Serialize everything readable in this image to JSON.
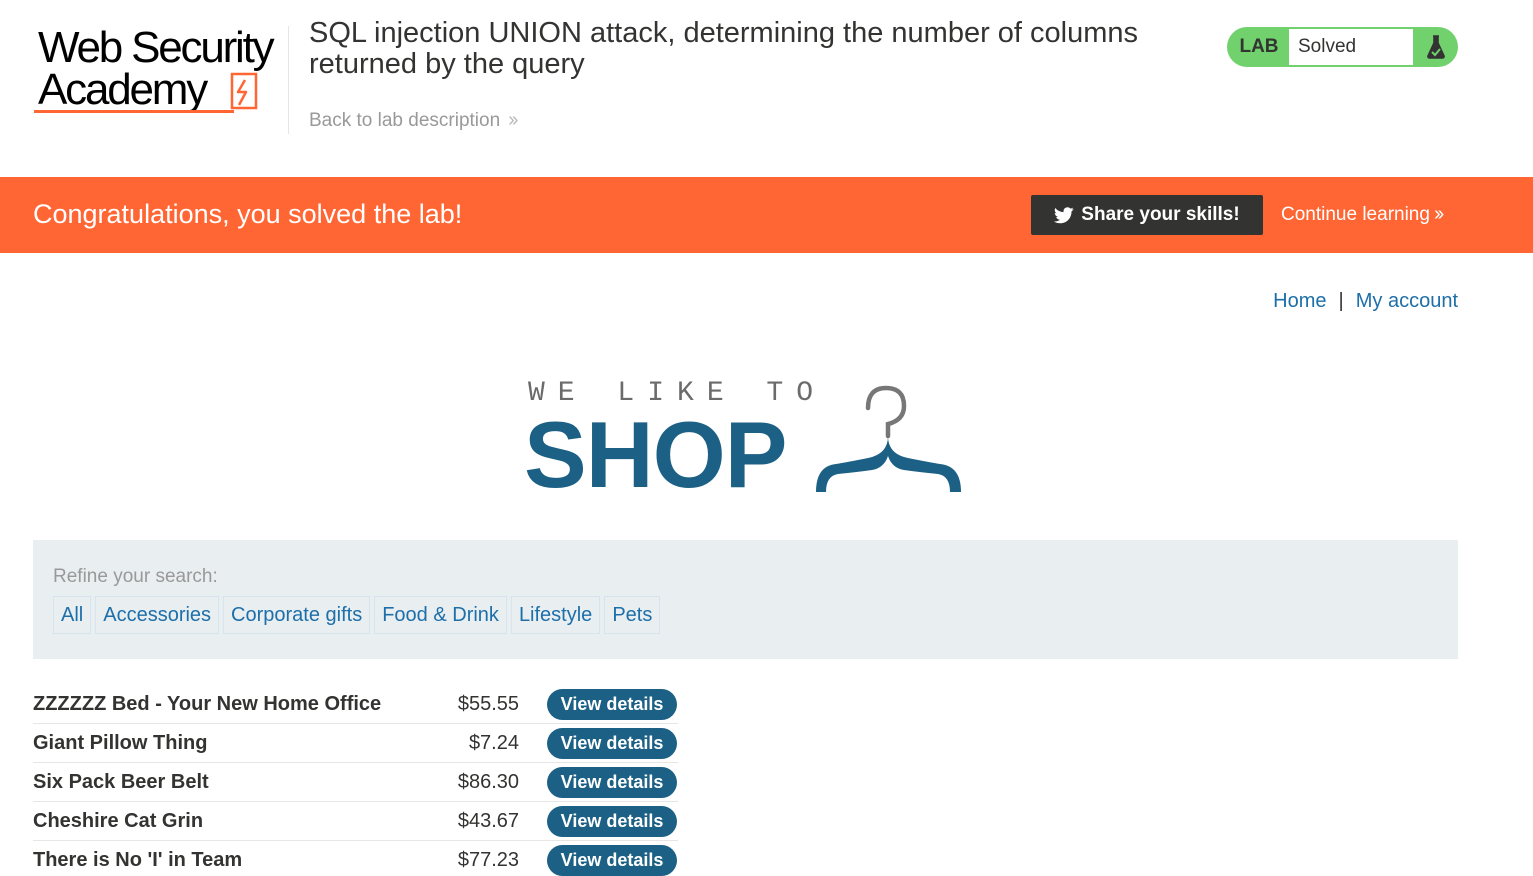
{
  "brand": {
    "line1": "Web Security",
    "line2": "Academy"
  },
  "header": {
    "lab_title": "SQL injection UNION attack, determining the number of columns returned by the query",
    "back_link": "Back to lab description",
    "lab_badge": "LAB",
    "lab_status": "Solved"
  },
  "banner": {
    "message": "Congratulations, you solved the lab!",
    "share_label": "Share your skills!",
    "continue_label": "Continue learning"
  },
  "nav": {
    "home": "Home",
    "separator": "|",
    "my_account": "My account"
  },
  "shop_logo": {
    "tagline": "WE LIKE TO",
    "word": "SHOP"
  },
  "filters": {
    "label": "Refine your search:",
    "items": [
      "All",
      "Accessories",
      "Corporate gifts",
      "Food & Drink",
      "Lifestyle",
      "Pets"
    ]
  },
  "products": [
    {
      "name": "ZZZZZZ Bed - Your New Home Office",
      "price": "$55.55",
      "action": "View details"
    },
    {
      "name": "Giant Pillow Thing",
      "price": "$7.24",
      "action": "View details"
    },
    {
      "name": "Six Pack Beer Belt",
      "price": "$86.30",
      "action": "View details"
    },
    {
      "name": "Cheshire Cat Grin",
      "price": "$43.67",
      "action": "View details"
    },
    {
      "name": "There is No 'I' in Team",
      "price": "$77.23",
      "action": "View details"
    }
  ],
  "colors": {
    "banner": "#ff6633",
    "solved_green": "#70d16d",
    "link_blue": "#1d6fa9",
    "button_blue": "#1c6185",
    "filter_bg": "#e9eef1"
  },
  "icons": {
    "share": "twitter-icon",
    "status": "flask-icon",
    "chevron": "double-chevron-right-icon",
    "logo": "hanger-icon"
  }
}
